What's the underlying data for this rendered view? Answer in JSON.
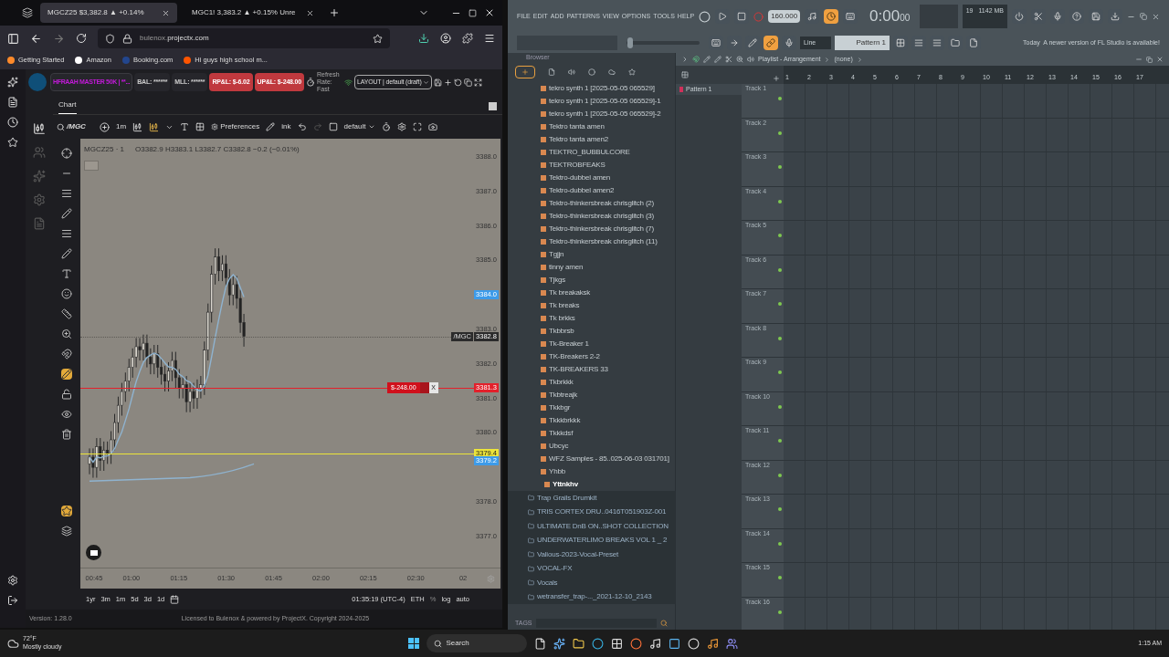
{
  "browser": {
    "tabs": [
      {
        "title": "MGCZ25 $3,382.8 ▲ +0.14%",
        "selected": true
      },
      {
        "title": "MGC1! 3,383.2 ▲ +0.15% Unre",
        "selected": false
      }
    ],
    "url_host": "bulenox.",
    "url_domain": "projectx.com",
    "bookmarks": [
      "Getting Started",
      "Amazon",
      "Booking.com",
      "Hi guys high school m..."
    ]
  },
  "trading_app": {
    "account": "HFRAAH MASTER 50K | **...",
    "stats": [
      {
        "text": "BAL: ******",
        "kind": "plain"
      },
      {
        "text": "MLL: ******",
        "kind": "plain"
      },
      {
        "text": "RP&L: $-6.02",
        "kind": "loss"
      },
      {
        "text": "UP&L: $-248.00",
        "kind": "loss"
      }
    ],
    "refresh": "Refresh Rate: Fast",
    "layout": "LAYOUT | default (draft)",
    "chart_tab": "Chart",
    "toolbar": {
      "symbol": "/MGC",
      "interval": "1m",
      "preferences": "Preferences",
      "ink": "ink",
      "template": "default"
    },
    "legend": {
      "symbol": "MGCZ25 · 1",
      "ohlc": "O3382.9 H3383.1 L3382.7 C3382.8 −0.2 (−0.01%)"
    },
    "price_ticks": [
      "3388.0",
      "3387.0",
      "3386.0",
      "3385.0",
      "3383.0",
      "3382.0",
      "3381.0",
      "3380.0",
      "3378.0",
      "3377.0"
    ],
    "price_markers": [
      {
        "text": "3384.0",
        "color": "#3d9be9",
        "kind": "label"
      },
      {
        "text": "3382.8",
        "tag": "/MGC",
        "color": "#2b2b2b",
        "kind": "dotted"
      },
      {
        "text": "3381.3",
        "color": "#e3202b",
        "kind": "solid"
      },
      {
        "text": "3379.4",
        "color": "#ece43a",
        "kind": "solid"
      },
      {
        "text": "3379.2",
        "color": "#3d9be9",
        "kind": "label"
      }
    ],
    "position": {
      "pnl": "$-248.00",
      "close": "X"
    },
    "time_ticks": [
      "00:45",
      "01:00",
      "01:15",
      "01:30",
      "01:45",
      "02:00",
      "02:15",
      "02:30",
      "02"
    ],
    "ranges": [
      "1yr",
      "3m",
      "1m",
      "5d",
      "3d",
      "1d"
    ],
    "clock": "01:35:19 (UTC-4)",
    "session": "ETH",
    "percent": "%",
    "log": "log",
    "auto": "auto",
    "version": "Version: 1.28.0",
    "license": "Licensed to Bulenox & powered by ProjectX. Copyright 2024-2025"
  },
  "fl_studio": {
    "menu": [
      "FILE",
      "EDIT",
      "ADD",
      "PATTERNS",
      "VIEW",
      "OPTIONS",
      "TOOLS",
      "HELP"
    ],
    "tempo": "160.000",
    "time": "0:00",
    "time_small": "00",
    "cpu": "19",
    "memory": "1142 MB",
    "pitch": {
      "level": 0.02
    },
    "snap": "Line",
    "pattern": "Pattern 1",
    "news": "Today  A newer version of FL Studio is available!",
    "browser_title": "Browser",
    "browser_items": [
      {
        "name": "tekro synth 1 [2025-05-05 065529]",
        "kind": "file",
        "selected": false
      },
      {
        "name": "tekro synth 1 [2025-05-05 065529]-1",
        "kind": "file",
        "selected": false
      },
      {
        "name": "tekro synth 1 [2025-05-05 065529]-2",
        "kind": "file",
        "selected": false
      },
      {
        "name": "Tektro tanta amen",
        "kind": "file",
        "selected": false
      },
      {
        "name": "Tektro tanta amen2",
        "kind": "file",
        "selected": false
      },
      {
        "name": "TEKTRO_BUBBULCORE",
        "kind": "file",
        "selected": false
      },
      {
        "name": "TEKTROBFEAKS",
        "kind": "file",
        "selected": false
      },
      {
        "name": "Tektro-dubbel amen",
        "kind": "file",
        "selected": false
      },
      {
        "name": "Tektro-dubbel amen2",
        "kind": "file",
        "selected": false
      },
      {
        "name": "Tektro-thinkersbreak chrisglitch (2)",
        "kind": "file",
        "selected": false
      },
      {
        "name": "Tektro-thinkersbreak chrisglitch (3)",
        "kind": "file",
        "selected": false
      },
      {
        "name": "Tektro-thinkersbreak chrisglitch (7)",
        "kind": "file",
        "selected": false
      },
      {
        "name": "Tektro-thinkersbreak chrisglitch (11)",
        "kind": "file",
        "selected": false
      },
      {
        "name": "Tgjjn",
        "kind": "file",
        "selected": false
      },
      {
        "name": "tinny amen",
        "kind": "file",
        "selected": false
      },
      {
        "name": "Tjkgs",
        "kind": "file",
        "selected": false
      },
      {
        "name": "Tk breakaksk",
        "kind": "file",
        "selected": false
      },
      {
        "name": "Tk breaks",
        "kind": "file",
        "selected": false
      },
      {
        "name": "Tk brkks",
        "kind": "file",
        "selected": false
      },
      {
        "name": "Tkbbrsb",
        "kind": "file",
        "selected": false
      },
      {
        "name": "Tk-Breaker 1",
        "kind": "file",
        "selected": false
      },
      {
        "name": "TK-Breakers 2-2",
        "kind": "file",
        "selected": false
      },
      {
        "name": "TK-BREAKERS 33",
        "kind": "file",
        "selected": false
      },
      {
        "name": "Tkbrkkk",
        "kind": "file",
        "selected": false
      },
      {
        "name": "Tkbtreajk",
        "kind": "file",
        "selected": false
      },
      {
        "name": "Tkkbgr",
        "kind": "file",
        "selected": false
      },
      {
        "name": "Tkkkbrkkk",
        "kind": "file",
        "selected": false
      },
      {
        "name": "Tkkkdsf",
        "kind": "file",
        "selected": false
      },
      {
        "name": "Ubcyc",
        "kind": "file",
        "selected": false
      },
      {
        "name": "WFZ Samples - 85..025-06-03 031701]",
        "kind": "file",
        "selected": false
      },
      {
        "name": "Yhbb",
        "kind": "file",
        "selected": false
      },
      {
        "name": "Yttnkhv",
        "kind": "file",
        "selected": true
      },
      {
        "name": "Trap Grails Drumkit",
        "kind": "folder",
        "selected": false
      },
      {
        "name": "TRIS CORTEX DRU..0416T051903Z-001",
        "kind": "folder",
        "selected": false
      },
      {
        "name": "ULTIMATE DnB ON..SHOT COLLECTION",
        "kind": "folder",
        "selected": false
      },
      {
        "name": "UNDERWATERLIMO BREAKS VOL 1 _ 2",
        "kind": "folder",
        "selected": false
      },
      {
        "name": "Valious-2023-Vocal-Preset",
        "kind": "folder",
        "selected": false
      },
      {
        "name": "VOCAL-FX",
        "kind": "folder",
        "selected": false
      },
      {
        "name": "Vocals",
        "kind": "folder",
        "selected": false
      },
      {
        "name": "wetransfer_trap-..._2021-12-10_2143",
        "kind": "folder",
        "selected": false
      }
    ],
    "tags": "TAGS",
    "playlist_title": "Playlist - Arrangement",
    "playlist_sub": "(none)",
    "pattern_list": [
      "Pattern 1"
    ],
    "bars": [
      "1",
      "2",
      "3",
      "4",
      "5",
      "6",
      "7",
      "8",
      "9",
      "10",
      "11",
      "12",
      "13",
      "14",
      "15",
      "16",
      "17"
    ],
    "tracks": [
      "Track 1",
      "Track 2",
      "Track 3",
      "Track 4",
      "Track 5",
      "Track 6",
      "Track 7",
      "Track 8",
      "Track 9",
      "Track 10",
      "Track 11",
      "Track 12",
      "Track 13",
      "Track 14",
      "Track 15",
      "Track 16"
    ]
  },
  "taskbar": {
    "temperature": "72°F",
    "weather": "Mostly cloudy",
    "search": "Search",
    "time": "1:15 AM"
  }
}
